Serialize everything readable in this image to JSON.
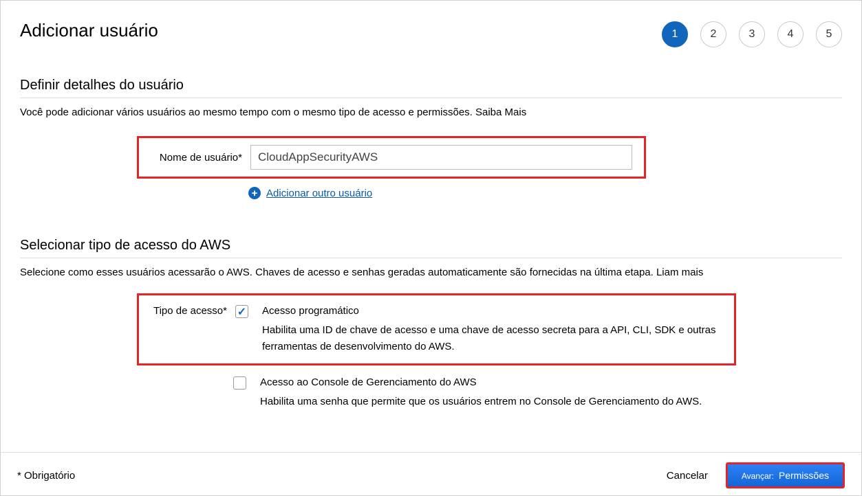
{
  "header": {
    "title": "Adicionar usuário",
    "steps": [
      "1",
      "2",
      "3",
      "4",
      "5"
    ],
    "active_step": 0
  },
  "section_details": {
    "title": "Definir detalhes do usuário",
    "description": "Você pode adicionar vários usuários ao mesmo tempo com o mesmo tipo de acesso e permissões. Saiba Mais",
    "username_label": "Nome de usuário*",
    "username_value": "CloudAppSecurityAWS",
    "add_another_label": "Adicionar outro usuário"
  },
  "section_access": {
    "title": "Selecionar tipo de acesso do AWS",
    "description": "Selecione como esses usuários acessarão o AWS. Chaves de acesso e senhas geradas automaticamente são fornecidas na última etapa. Liam mais",
    "access_label": "Tipo de acesso*",
    "option1": {
      "title": "Acesso programático",
      "description": "Habilita uma ID de chave de acesso e uma chave de acesso secreta para a API, CLI, SDK e outras ferramentas de desenvolvimento do AWS.",
      "checked": true
    },
    "option2": {
      "title": "Acesso ao Console de Gerenciamento do AWS",
      "description": "Habilita uma senha que permite que os usuários entrem no Console de Gerenciamento do AWS.",
      "checked": false
    }
  },
  "footer": {
    "required_note": "* Obrigatório",
    "cancel_label": "Cancelar",
    "next_prefix": "Avançar:",
    "next_label": "Permissões"
  }
}
